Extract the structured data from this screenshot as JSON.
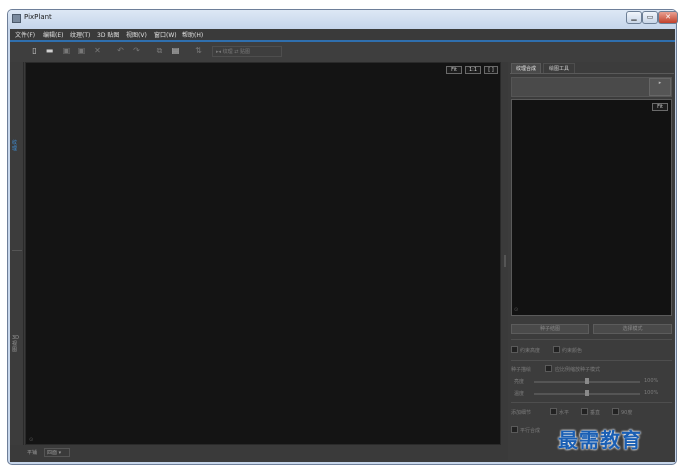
{
  "window": {
    "title": "PixPlant"
  },
  "window_controls": {
    "minimize": "▁",
    "maximize": "▭",
    "close": "✕"
  },
  "menubar": {
    "items": [
      "文件(F)",
      "编辑(E)",
      "纹理(T)",
      "3D 贴图",
      "视图(V)",
      "窗口(W)",
      "帮助(H)"
    ]
  },
  "toolbar": {
    "group_label": "▸◂ 纹理 ⇄ 贴图"
  },
  "left_strip": {
    "label_top": "纹理",
    "label_bottom": "3D 视图"
  },
  "viewport": {
    "fit": "Fit",
    "one_to_one": "1:1",
    "frame": "[ ]",
    "axis": "⊙"
  },
  "status": {
    "label": "平铺",
    "select": "四面 ▾"
  },
  "right_panel": {
    "tabs": [
      "纹理合成",
      "绘图工具"
    ],
    "top_button": "▸",
    "fit": "Fit",
    "button_seed": "种子结图",
    "button_mode": "选择模式",
    "options": {
      "constrain_height": "约束高度",
      "constrain_color": "约束颜色",
      "seed_adjust": "种子描绘",
      "use_seed_mode": "应比例缩放种子模式",
      "brightness": "亮度",
      "scale": "温度",
      "pct1": "100%",
      "pct2": "100%",
      "add_label": "添加细节",
      "horizontal": "水平",
      "vertical": "垂直",
      "deg": "90度",
      "parallel": "平行合成"
    }
  },
  "watermark": "最需教育"
}
